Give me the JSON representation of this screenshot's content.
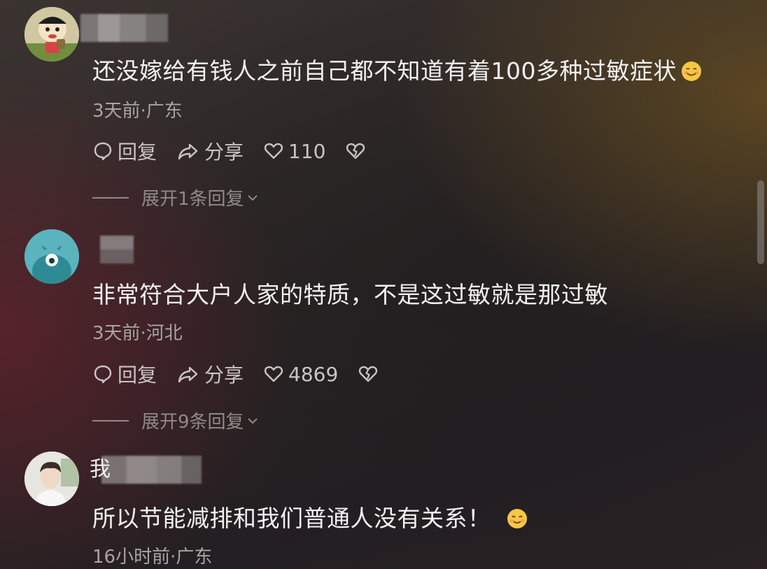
{
  "comments": [
    {
      "text": "还没嫁给有钱人之前自己都不知道有着100多种过敏症状",
      "emoji": "smiling-face-emoji",
      "meta": "3天前·广东",
      "reply_label": "回复",
      "share_label": "分享",
      "likes": "110",
      "expand_label": "展开1条回复"
    },
    {
      "text": "非常符合大户人家的特质，不是这过敏就是那过敏",
      "meta": "3天前·河北",
      "reply_label": "回复",
      "share_label": "分享",
      "likes": "4869",
      "expand_label": "展开9条回复"
    },
    {
      "username_partial": "我",
      "text": "所以节能减排和我们普通人没有关系！",
      "emoji": "blushing-smile-emoji",
      "meta": "16小时前·广东"
    }
  ],
  "colors": {
    "text_primary": "#f2f2f2",
    "text_meta": "#a9a4a4",
    "action": "#c9c5c5",
    "expand": "#8e8a8a",
    "emoji_yellow": "#f7c744"
  },
  "icons": {
    "reply": "comment-bubble-icon",
    "share": "share-arrow-icon",
    "like": "heart-icon",
    "dislike": "broken-heart-icon",
    "expand": "chevron-down-icon"
  }
}
